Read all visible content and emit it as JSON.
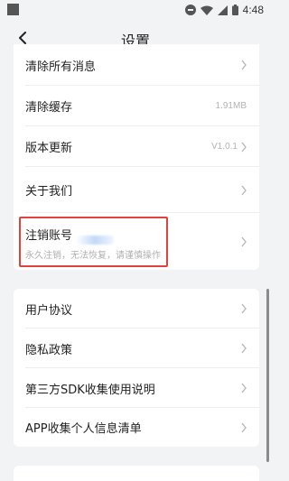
{
  "status_bar": {
    "time": "4:48"
  },
  "header": {
    "title": "设置"
  },
  "settings_group1": [
    {
      "id": "clear-messages",
      "label": "清除所有消息",
      "value": ""
    },
    {
      "id": "clear-cache",
      "label": "清除缓存",
      "value": "1.91MB"
    },
    {
      "id": "version-update",
      "label": "版本更新",
      "value": "V1.0.1"
    },
    {
      "id": "about-us",
      "label": "关于我们",
      "value": ""
    }
  ],
  "delete_account": {
    "label": "注销账号",
    "subtitle": "永久注销，无法恢复，请谨慎操作"
  },
  "settings_group2": [
    {
      "id": "user-agreement",
      "label": "用户协议"
    },
    {
      "id": "privacy-policy",
      "label": "隐私政策"
    },
    {
      "id": "third-party-sdk",
      "label": "第三方SDK收集使用说明"
    },
    {
      "id": "personal-info-list",
      "label": "APP收集个人信息清单"
    }
  ],
  "colors": {
    "page_bg": "#f2f3f5",
    "card_bg": "#ffffff",
    "highlight": "#e0433e",
    "muted_text": "#b0b0b0"
  }
}
